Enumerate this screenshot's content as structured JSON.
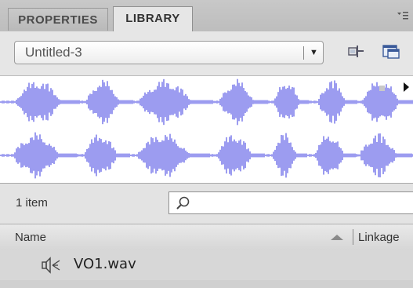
{
  "tabs": [
    {
      "label": "PROPERTIES",
      "active": false
    },
    {
      "label": "LIBRARY",
      "active": true
    }
  ],
  "library": {
    "selected": "Untitled-3"
  },
  "status": {
    "item_count": "1 item"
  },
  "search": {
    "value": "",
    "placeholder": ""
  },
  "columns": {
    "name": "Name",
    "linkage": "Linkage"
  },
  "items": [
    {
      "name": "VO1.wav",
      "type_icon": "sound-icon"
    }
  ],
  "colors": {
    "waveform": "#9c9cf0",
    "accent_tab": "#e6e6e6"
  },
  "icons": {
    "panel_menu": "panel-menu-icon",
    "pin": "pin-icon",
    "new_library": "new-library-panel-icon",
    "search": "search-icon",
    "play": "play-icon",
    "stop": "stop-icon"
  }
}
